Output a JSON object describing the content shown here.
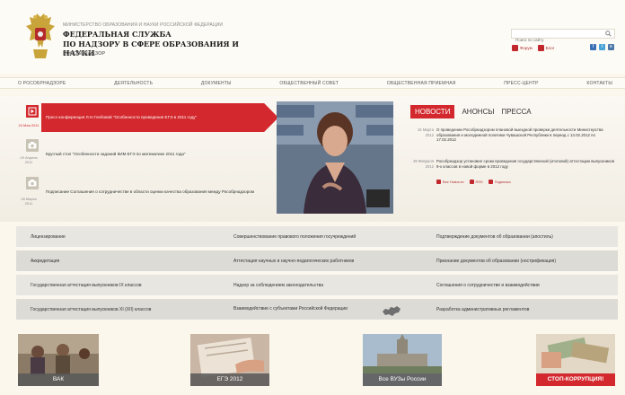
{
  "header": {
    "ministry": "Министерство образования и науки Российской Федерации",
    "title_line1": "ФЕДЕРАЛЬНАЯ СЛУЖБА",
    "title_line2": "ПО НАДЗОРУ В СФЕРЕ ОБРАЗОВАНИЯ И НАУКИ",
    "short_name": "РОСОБРНАДЗОР",
    "search_placeholder": "Поиск по сайту",
    "links": [
      "Форум",
      "Блог"
    ],
    "social": [
      "f",
      "t",
      "в"
    ],
    "icons": {
      "emblem": "double-headed-eagle-icon",
      "search": "search-icon"
    },
    "colors": {
      "accent": "#d3282d",
      "background": "#fbf7ec"
    }
  },
  "nav": [
    "О Рособрнадзоре",
    "Деятельность",
    "Документы",
    "Общественный совет",
    "Общественная приемная",
    "Пресс-центр",
    "Контакты"
  ],
  "events": [
    {
      "date": "24 Мая 2011",
      "text": "Пресс-конференция Л.Н.Глебовой \"Особенности проведения ЕГЭ в 2011 году\"",
      "active": true,
      "icon": "play-icon"
    },
    {
      "date": "29 Апреля 2011",
      "text": "Круглый стол \"Особенности заданий КИМ ЕГЭ по математике 2011 года\"",
      "active": false,
      "icon": "camera-icon"
    },
    {
      "date": "26 Марта 2011",
      "text": "Подписание Соглашения о сотрудничестве в области оценки качества образования между Рособрнадзором",
      "active": false,
      "icon": "camera-icon"
    }
  ],
  "news": {
    "tabs": [
      "НОВОСТИ",
      "АНОНСЫ",
      "ПРЕССА"
    ],
    "items": [
      {
        "date": "15 Марта 2012",
        "text": "О проведении Рособрнадзором плановой выездной проверки деятельности Министерства образования и молодежной политики Чувашской Республики в период с 13.02.2012 по 17.02.2012"
      },
      {
        "date": "29 Февраля 2012",
        "text": "Рособрнадзор установил сроки проведения государственной (итоговой) аттестации выпускников 9-х классов в новой форме в 2012 году"
      }
    ],
    "links": [
      "Все Новости",
      "RSS",
      "Подписка"
    ]
  },
  "grid": [
    [
      "Лицензирование",
      "Совершенствование правового положения госучреждений",
      "Подтверждение документов об образовании (апостиль)"
    ],
    [
      "Аккредитация",
      "Аттестация научных и научно-педагогических работников",
      "Признание документов об образовании (нострификация)"
    ],
    [
      "Государственная аттестация выпускников IX классов",
      "Надзор за соблюдением законодательства",
      "Соглашения о сотрудничестве и взаимодействии"
    ],
    [
      "Государственная аттестация выпускников XI (XII) классов",
      "Взаимодействие с субъектами Российской Федерации",
      "Разработка административных регламентов"
    ]
  ],
  "banners": [
    {
      "label": "ВАК"
    },
    {
      "label": "ЕГЭ 2012"
    },
    {
      "label": "Все ВУЗы России"
    },
    {
      "label": "СТОП-КОРРУПЦИЯ!"
    }
  ]
}
